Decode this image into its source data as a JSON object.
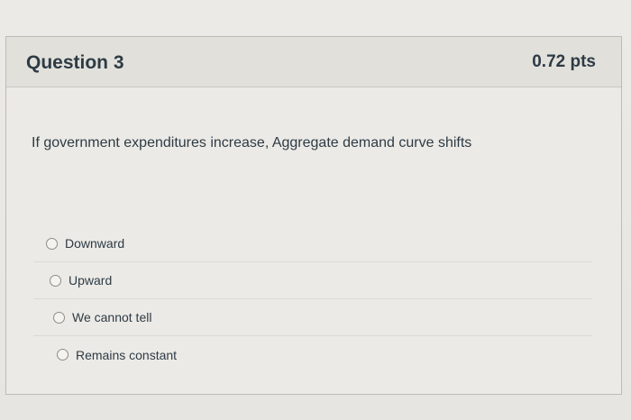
{
  "question": {
    "title": "Question 3",
    "points": "0.72 pts",
    "text": "If government expenditures increase, Aggregate demand curve shifts"
  },
  "answers": [
    {
      "label": "Downward",
      "selected": false
    },
    {
      "label": "Upward",
      "selected": false
    },
    {
      "label": "We cannot tell",
      "selected": false
    },
    {
      "label": "Remains constant",
      "selected": false
    }
  ]
}
